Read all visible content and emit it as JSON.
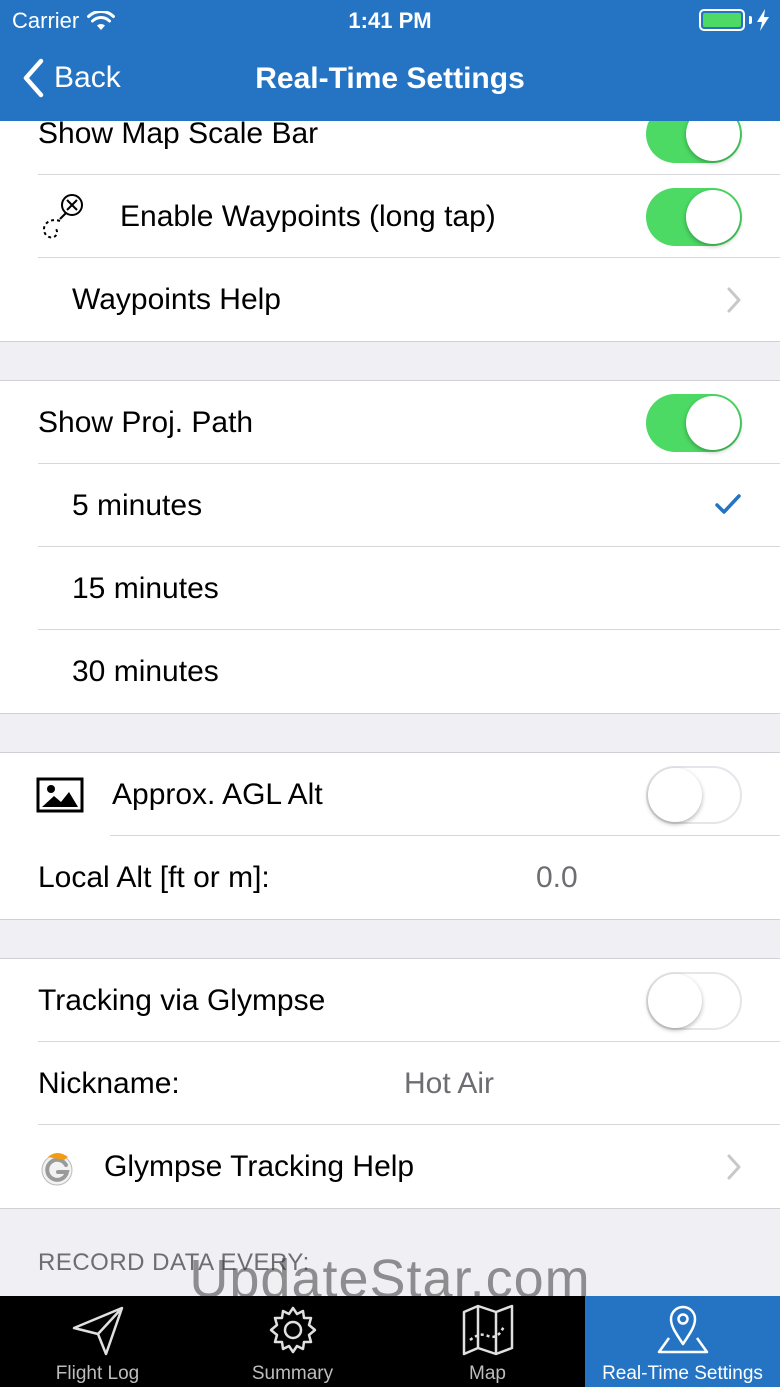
{
  "status": {
    "carrier": "Carrier",
    "time": "1:41 PM"
  },
  "nav": {
    "back_label": "Back",
    "title": "Real-Time Settings"
  },
  "section1": {
    "show_map_scale_bar": {
      "label": "Show Map Scale Bar",
      "on": true
    },
    "enable_waypoints": {
      "label": "Enable Waypoints (long tap)",
      "on": true
    },
    "waypoints_help": {
      "label": "Waypoints Help"
    }
  },
  "section2": {
    "show_proj_path": {
      "label": "Show Proj. Path",
      "on": true
    },
    "options": [
      {
        "label": "5 minutes",
        "selected": true
      },
      {
        "label": "15 minutes",
        "selected": false
      },
      {
        "label": "30 minutes",
        "selected": false
      }
    ]
  },
  "section3": {
    "approx_agl_alt": {
      "label": "Approx. AGL Alt",
      "on": false
    },
    "local_alt": {
      "label": "Local Alt [ft or m]:",
      "value": "0.0"
    }
  },
  "section4": {
    "tracking_glympse": {
      "label": "Tracking via Glympse",
      "on": false
    },
    "nickname": {
      "label": "Nickname:",
      "value": "Hot Air"
    },
    "glympse_help": {
      "label": "Glympse Tracking Help"
    }
  },
  "record_caption": "RECORD DATA EVERY:",
  "watermark": "UpdateStar.com",
  "tabs": [
    {
      "label": "Flight Log",
      "icon": "paper-plane-icon",
      "active": false
    },
    {
      "label": "Summary",
      "icon": "gear-icon",
      "active": false
    },
    {
      "label": "Map",
      "icon": "map-icon",
      "active": false
    },
    {
      "label": "Real-Time Settings",
      "icon": "location-pin-icon",
      "active": true
    }
  ],
  "colors": {
    "nav": "#2574c4",
    "toggle_on": "#4cd964",
    "check": "#2574c4"
  }
}
